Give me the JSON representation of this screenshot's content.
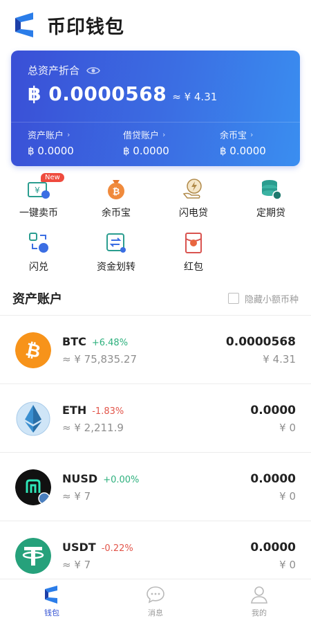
{
  "app": {
    "title": "币印钱包"
  },
  "card": {
    "label": "总资产折合",
    "total_value": "฿ 0.0000568",
    "total_cny": "≈ ¥ 4.31",
    "accounts": [
      {
        "name": "资产账户",
        "value": "฿ 0.0000"
      },
      {
        "name": "借贷账户",
        "value": "฿ 0.0000"
      },
      {
        "name": "余币宝",
        "value": "฿ 0.0000"
      }
    ]
  },
  "actions": [
    {
      "label": "一键卖币",
      "icon": "sell-coin-icon",
      "badge": "New"
    },
    {
      "label": "余币宝",
      "icon": "coin-bag-icon"
    },
    {
      "label": "闪电贷",
      "icon": "flash-loan-icon"
    },
    {
      "label": "定期贷",
      "icon": "fixed-loan-icon"
    },
    {
      "label": "闪兑",
      "icon": "flash-swap-icon"
    },
    {
      "label": "资金划转",
      "icon": "transfer-icon"
    },
    {
      "label": "红包",
      "icon": "red-packet-icon"
    }
  ],
  "section": {
    "title": "资产账户",
    "hide_small_label": "隐藏小额币种"
  },
  "coins": [
    {
      "symbol": "BTC",
      "change": "+6.48%",
      "direction": "up",
      "price": "≈ ¥ 75,835.27",
      "amount": "0.0000568",
      "cny": "¥ 4.31",
      "icon": "btc-icon",
      "color": "#f7931a"
    },
    {
      "symbol": "ETH",
      "change": "-1.83%",
      "direction": "down",
      "price": "≈ ¥ 2,211.9",
      "amount": "0.0000",
      "cny": "¥ 0",
      "icon": "eth-icon",
      "color": "#cfe5f7"
    },
    {
      "symbol": "NUSD",
      "change": "+0.00%",
      "direction": "up",
      "price": "≈ ¥ 7",
      "amount": "0.0000",
      "cny": "¥ 0",
      "icon": "nusd-icon",
      "color": "#111111"
    },
    {
      "symbol": "USDT",
      "change": "-0.22%",
      "direction": "down",
      "price": "≈ ¥ 7",
      "amount": "0.0000",
      "cny": "¥ 0",
      "icon": "usdt-icon",
      "color": "#26a17b"
    }
  ],
  "nav": [
    {
      "label": "钱包",
      "icon": "wallet-icon",
      "active": true
    },
    {
      "label": "消息",
      "icon": "message-icon"
    },
    {
      "label": "我的",
      "icon": "profile-icon"
    }
  ],
  "colors": {
    "accent": "#3150d2",
    "card_start": "#3a4fd6",
    "card_end": "#3a8ef0",
    "up": "#2db07d",
    "down": "#e2554a"
  }
}
